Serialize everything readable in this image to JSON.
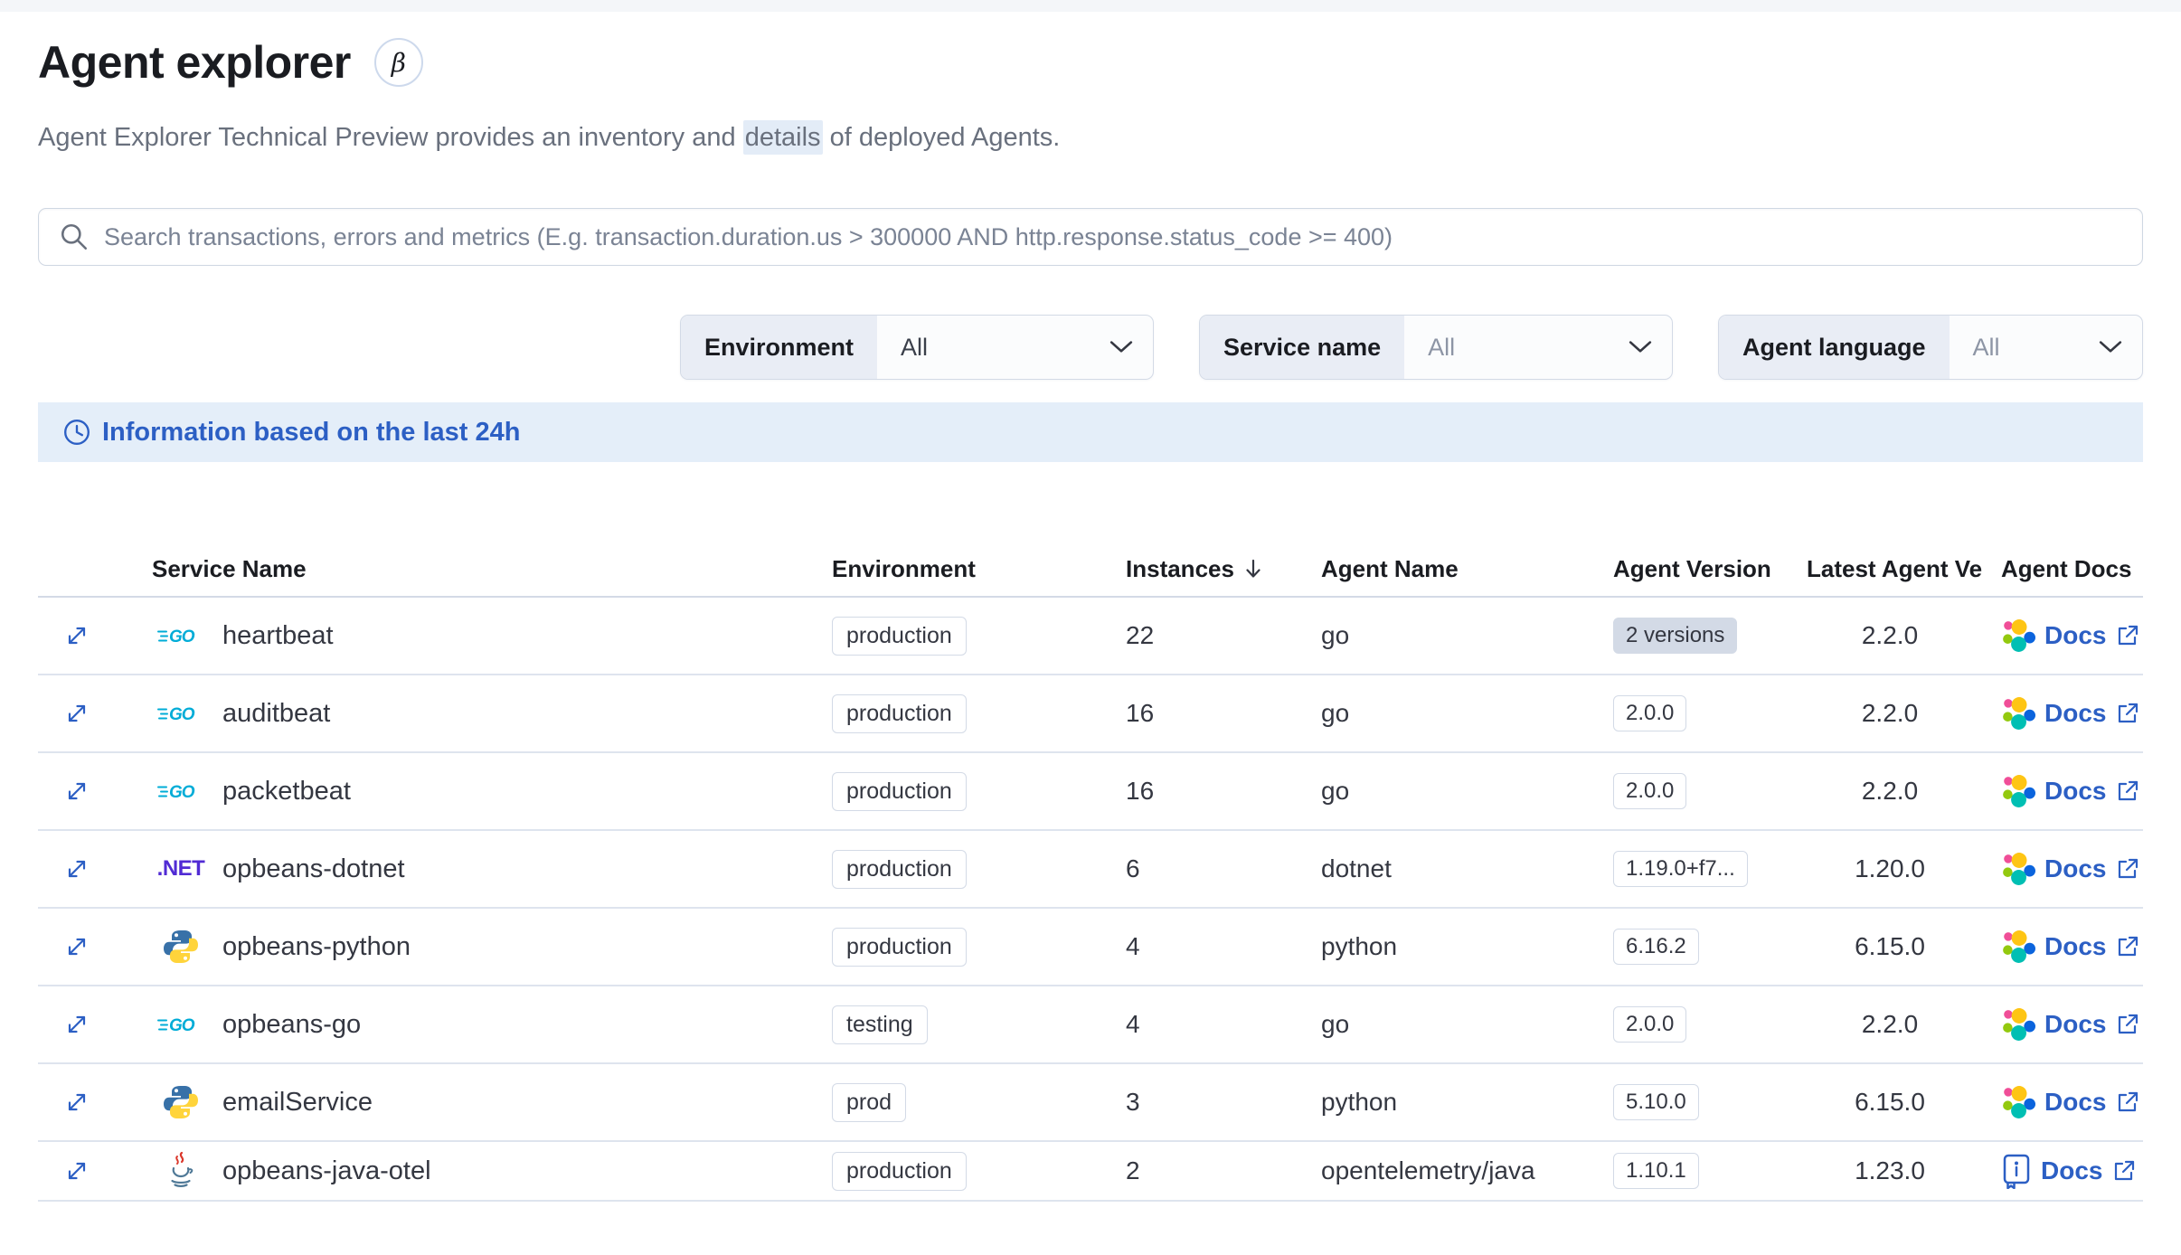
{
  "header": {
    "title": "Agent explorer",
    "beta_symbol": "β",
    "subtitle": {
      "before": "Agent Explorer Technical Preview provides an inventory and ",
      "highlight": "details",
      "after": " of deployed Agents."
    }
  },
  "search": {
    "placeholder": "Search transactions, errors and metrics (E.g. transaction.duration.us > 300000 AND http.response.status_code >= 400)"
  },
  "filters": [
    {
      "label": "Environment",
      "value": "All"
    },
    {
      "label": "Service name",
      "value": "All"
    },
    {
      "label": "Agent language",
      "value": "All"
    }
  ],
  "banner": {
    "text": "Information based on the last 24h"
  },
  "table": {
    "columns": {
      "service": "Service Name",
      "environment": "Environment",
      "instances": "Instances",
      "agent_name": "Agent Name",
      "agent_version": "Agent Version",
      "latest_version": "Latest Agent Ve",
      "docs": "Agent Docs"
    },
    "sort": {
      "column": "Instances",
      "direction": "desc"
    },
    "rows": [
      {
        "service": "heartbeat",
        "language": "go",
        "environment": "production",
        "instances": "22",
        "agent_name": "go",
        "agent_version": "2 versions",
        "version_badge": "filled",
        "latest_version": "2.2.0",
        "docs_label": "Docs",
        "docs_icon": "elastic"
      },
      {
        "service": "auditbeat",
        "language": "go",
        "environment": "production",
        "instances": "16",
        "agent_name": "go",
        "agent_version": "2.0.0",
        "version_badge": "hollow",
        "latest_version": "2.2.0",
        "docs_label": "Docs",
        "docs_icon": "elastic"
      },
      {
        "service": "packetbeat",
        "language": "go",
        "environment": "production",
        "instances": "16",
        "agent_name": "go",
        "agent_version": "2.0.0",
        "version_badge": "hollow",
        "latest_version": "2.2.0",
        "docs_label": "Docs",
        "docs_icon": "elastic"
      },
      {
        "service": "opbeans-dotnet",
        "language": "dotnet",
        "environment": "production",
        "instances": "6",
        "agent_name": "dotnet",
        "agent_version": "1.19.0+f7...",
        "version_badge": "hollow",
        "latest_version": "1.20.0",
        "docs_label": "Docs",
        "docs_icon": "elastic"
      },
      {
        "service": "opbeans-python",
        "language": "python",
        "environment": "production",
        "instances": "4",
        "agent_name": "python",
        "agent_version": "6.16.2",
        "version_badge": "hollow",
        "latest_version": "6.15.0",
        "docs_label": "Docs",
        "docs_icon": "elastic"
      },
      {
        "service": "opbeans-go",
        "language": "go",
        "environment": "testing",
        "instances": "4",
        "agent_name": "go",
        "agent_version": "2.0.0",
        "version_badge": "hollow",
        "latest_version": "2.2.0",
        "docs_label": "Docs",
        "docs_icon": "elastic"
      },
      {
        "service": "emailService",
        "language": "python",
        "environment": "prod",
        "instances": "3",
        "agent_name": "python",
        "agent_version": "5.10.0",
        "version_badge": "hollow",
        "latest_version": "6.15.0",
        "docs_label": "Docs",
        "docs_icon": "elastic"
      },
      {
        "service": "opbeans-java-otel",
        "language": "java",
        "environment": "production",
        "instances": "2",
        "agent_name": "opentelemetry/java",
        "agent_version": "1.10.1",
        "version_badge": "hollow",
        "latest_version": "1.23.0",
        "docs_label": "Docs",
        "docs_icon": "book"
      }
    ]
  },
  "icons": {
    "go_label": "GO",
    "dotnet_label": ".NET"
  },
  "colors": {
    "accent": "#2C5FC4",
    "text": "#343741",
    "subdued": "#69707D",
    "border": "#D3DAE6",
    "badge_fill": "#D3DAE6",
    "banner_bg": "#E4EEF9",
    "highlight_bg": "#E3ECF7",
    "label_bg": "#E9EDF5",
    "go_blue": "#00ACD7",
    "dotnet_purple": "#512BD4",
    "elastic_yellow": "#FEC514",
    "elastic_pink": "#F04E98",
    "elastic_teal": "#00BFB3",
    "elastic_blue": "#0B64DD",
    "elastic_green": "#93C90E"
  }
}
